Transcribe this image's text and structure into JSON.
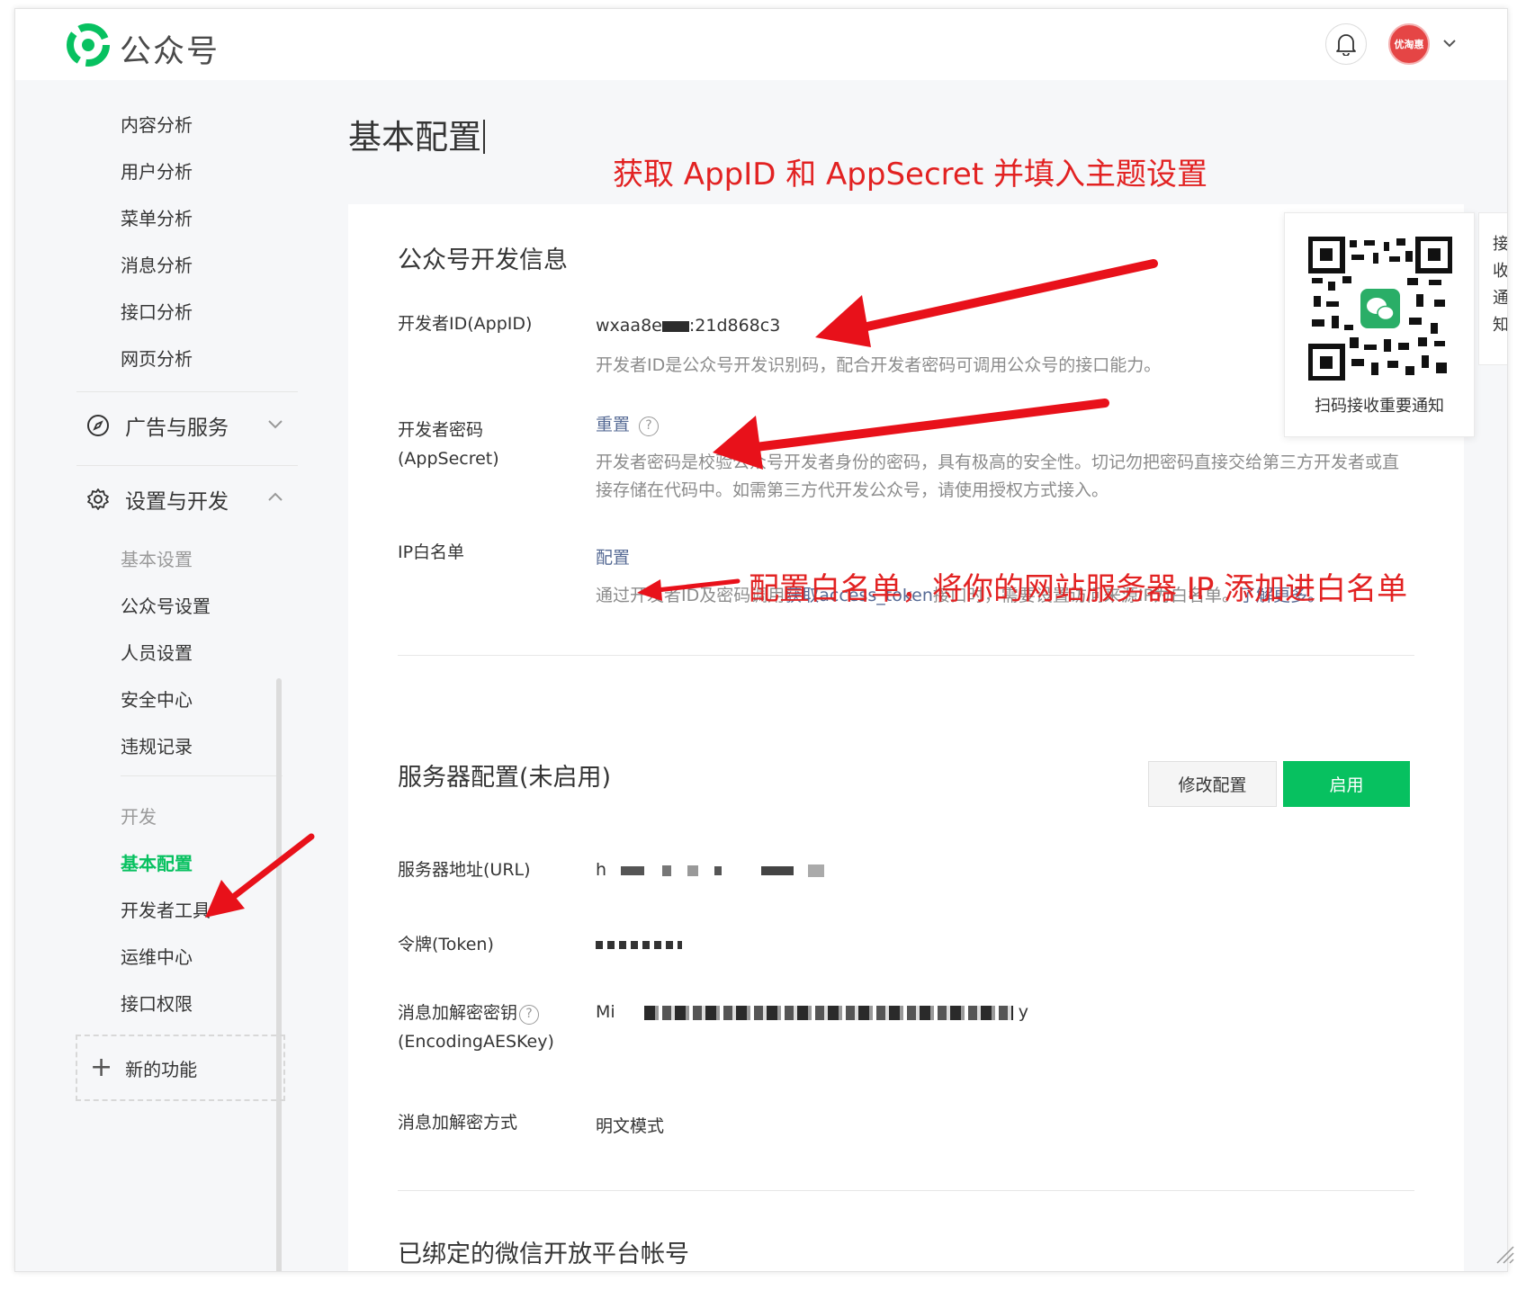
{
  "header": {
    "brand": "公众号",
    "avatar_text": "优淘惠"
  },
  "sidebar": {
    "analysis_items": [
      {
        "label": "内容分析"
      },
      {
        "label": "用户分析"
      },
      {
        "label": "菜单分析"
      },
      {
        "label": "消息分析"
      },
      {
        "label": "接口分析"
      },
      {
        "label": "网页分析"
      }
    ],
    "ads_group": "广告与服务",
    "settings_group": "设置与开发",
    "settings_items": [
      {
        "label": "基本设置"
      },
      {
        "label": "公众号设置"
      },
      {
        "label": "人员设置"
      },
      {
        "label": "安全中心"
      },
      {
        "label": "违规记录"
      }
    ],
    "dev_heading": "开发",
    "dev_items": [
      {
        "label": "基本配置"
      },
      {
        "label": "开发者工具"
      },
      {
        "label": "运维中心"
      },
      {
        "label": "接口权限"
      }
    ],
    "new_feature": "新的功能"
  },
  "page": {
    "title": "基本配置"
  },
  "annotations": {
    "top": "获取 AppID 和 AppSecret 并填入主题设置",
    "ip": "配置白名单，将你的网站服务器 IP 添加进白名单"
  },
  "dev_info": {
    "title": "公众号开发信息",
    "appid_label": "开发者ID(AppID)",
    "appid_prefix": "wxaa8e",
    "appid_suffix": ":21d868c3",
    "appid_desc": "开发者ID是公众号开发识别码，配合开发者密码可调用公众号的接口能力。",
    "secret_label": "开发者密码(AppSecret)",
    "secret_action": "重置",
    "secret_desc": "开发者密码是校验公众号开发者身份的密码，具有极高的安全性。切记勿把密码直接交给第三方开发者或直接存储在代码中。如需第三方代开发公众号，请使用授权方式接入。",
    "ip_label": "IP白名单",
    "ip_action": "配置",
    "ip_desc_1": "通过开发者ID及密码调用",
    "ip_desc_link": "获取access_token",
    "ip_desc_2": "接口时，需要设置访问来源IP为白名单。",
    "ip_desc_more": "了解更多。"
  },
  "server": {
    "title": "服务器配置(未启用)",
    "edit_button": "修改配置",
    "enable_button": "启用",
    "url_label": "服务器地址(URL)",
    "url_prefix": "h",
    "token_label": "令牌(Token)",
    "aes_label": "消息加解密密钥",
    "aes_label_2": "(EncodingAESKey)",
    "aes_prefix": "Mi",
    "aes_suffix": "y",
    "mode_label": "消息加解密方式",
    "mode_value": "明文模式"
  },
  "bound": {
    "title": "已绑定的微信开放平台帐号"
  },
  "qr": {
    "caption": "扫码接收重要通知"
  },
  "side_tab": {
    "chars": [
      "接",
      "收",
      "通",
      "知"
    ]
  },
  "colors": {
    "brand_green": "#07c160",
    "link": "#576b95",
    "annotation_red": "#e22222"
  }
}
